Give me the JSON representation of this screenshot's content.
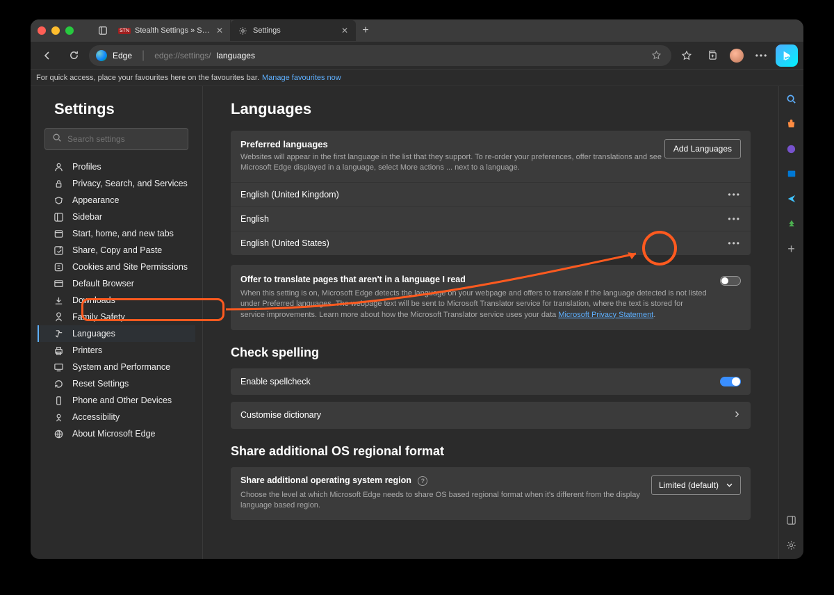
{
  "tabs": [
    {
      "label": "Stealth Settings » Source of IT",
      "favicon": "STN"
    },
    {
      "label": "Settings",
      "favicon": "gear"
    }
  ],
  "address": {
    "prefix": "Edge",
    "url_prefix": "edge://settings/",
    "url_suffix": "languages"
  },
  "favbar": {
    "text": "For quick access, place your favourites here on the favourites bar.",
    "link": "Manage favourites now"
  },
  "sidebar": {
    "title": "Settings",
    "search_placeholder": "Search settings",
    "items": [
      {
        "label": "Profiles"
      },
      {
        "label": "Privacy, Search, and Services"
      },
      {
        "label": "Appearance"
      },
      {
        "label": "Sidebar"
      },
      {
        "label": "Start, home, and new tabs"
      },
      {
        "label": "Share, Copy and Paste"
      },
      {
        "label": "Cookies and Site Permissions"
      },
      {
        "label": "Default Browser"
      },
      {
        "label": "Downloads"
      },
      {
        "label": "Family Safety"
      },
      {
        "label": "Languages"
      },
      {
        "label": "Printers"
      },
      {
        "label": "System and Performance"
      },
      {
        "label": "Reset Settings"
      },
      {
        "label": "Phone and Other Devices"
      },
      {
        "label": "Accessibility"
      },
      {
        "label": "About Microsoft Edge"
      }
    ],
    "selected_index": 10
  },
  "main": {
    "title": "Languages",
    "preferred": {
      "title": "Preferred languages",
      "desc": "Websites will appear in the first language in the list that they support. To re-order your preferences, offer translations and see Microsoft Edge displayed in a language, select More actions ... next to a language.",
      "add_btn": "Add Languages",
      "languages": [
        "English (United Kingdom)",
        "English",
        "English (United States)"
      ]
    },
    "translate": {
      "title": "Offer to translate pages that aren't in a language I read",
      "desc_pre": "When this setting is on, Microsoft Edge detects the language on your webpage and offers to translate if the language detected is not listed under Preferred languages. The webpage text will be sent to Microsoft Translator service for translation, where the text is stored for service improvements. Learn more about how the Microsoft Translator service uses your data ",
      "link": "Microsoft Privacy Statement",
      "desc_post": ".",
      "on": false
    },
    "spelling": {
      "header": "Check spelling",
      "enable_label": "Enable spellcheck",
      "enable_on": true,
      "dict_label": "Customise dictionary"
    },
    "regional": {
      "header": "Share additional OS regional format",
      "title": "Share additional operating system region",
      "desc": "Choose the level at which Microsoft Edge needs to share OS based regional format when it's different from the display language based region.",
      "select_value": "Limited (default)"
    }
  }
}
